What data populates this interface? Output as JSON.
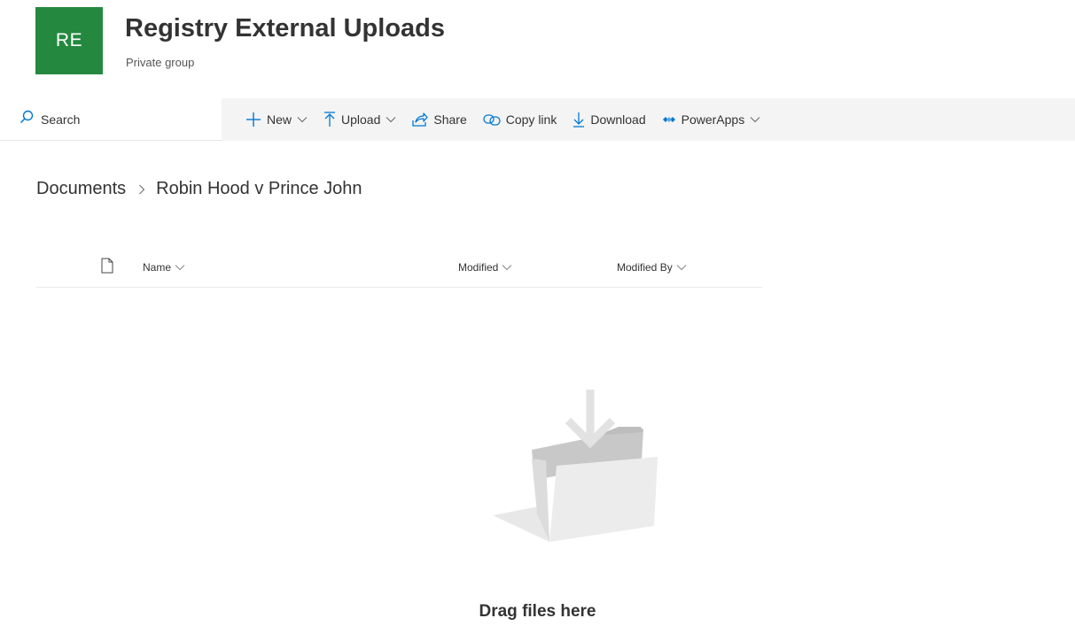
{
  "site": {
    "logo_initials": "RE",
    "title": "Registry External Uploads",
    "subtitle": "Private group",
    "brand_color": "#24893f"
  },
  "command_bar": {
    "search_label": "Search",
    "commands": [
      {
        "label": "New",
        "icon": "plus-icon",
        "has_dropdown": true
      },
      {
        "label": "Upload",
        "icon": "upload-arrow-icon",
        "has_dropdown": true
      },
      {
        "label": "Share",
        "icon": "share-icon",
        "has_dropdown": false
      },
      {
        "label": "Copy link",
        "icon": "link-icon",
        "has_dropdown": false
      },
      {
        "label": "Download",
        "icon": "download-arrow-icon",
        "has_dropdown": false
      },
      {
        "label": "PowerApps",
        "icon": "powerapps-icon",
        "has_dropdown": true
      }
    ],
    "accent_color": "#0078d4"
  },
  "breadcrumb": {
    "items": [
      "Documents",
      "Robin Hood v Prince John"
    ]
  },
  "list": {
    "columns": [
      "Name",
      "Modified",
      "Modified By"
    ]
  },
  "empty_state": {
    "message": "Drag files here",
    "icon": "empty-folder-icon"
  }
}
